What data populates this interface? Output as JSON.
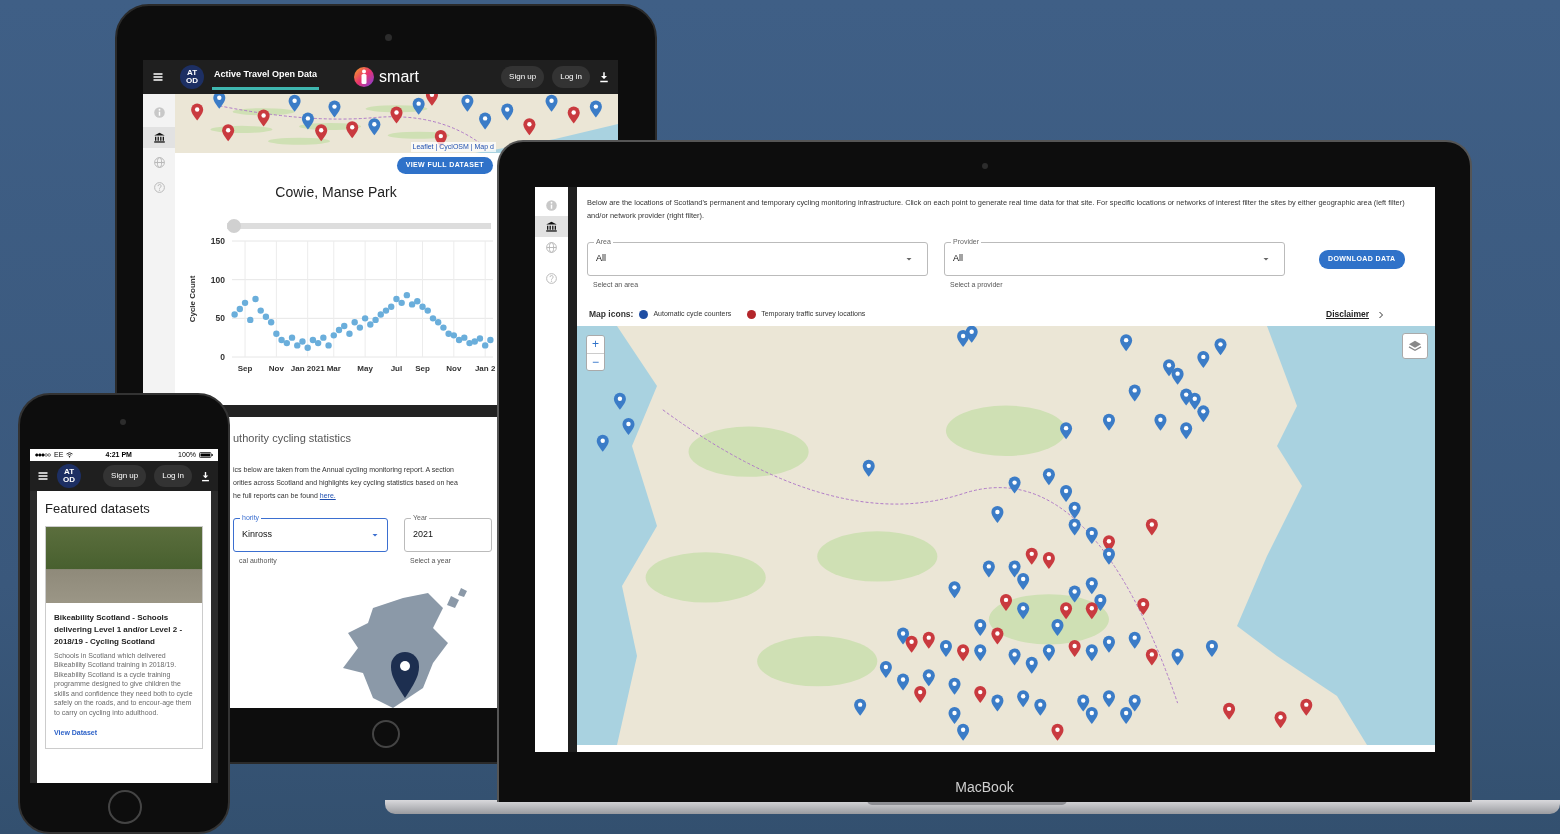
{
  "tablet": {
    "navbar": {
      "logo_text": "AT\nOD",
      "tab": {
        "label": "Active Travel Open Data",
        "selected": true
      },
      "brand": "smart",
      "buttons": [
        "Sign up",
        "Log in"
      ]
    },
    "sidebar": [
      {
        "kind": "info",
        "selected": false
      },
      {
        "kind": "bank",
        "selected": true
      },
      {
        "kind": "globe",
        "selected": false
      },
      {
        "kind": "help",
        "selected": false
      }
    ],
    "map_attribution": "Leaflet | CyclOSM | Map d",
    "view_button": "VIEW FULL DATASET",
    "chart_title": "Cowie, Manse Park",
    "range_slider": {
      "level": 0
    },
    "chart_data": {
      "type": "scatter",
      "grid": true,
      "ylabel": "Cycle Count",
      "ylim": [
        0,
        150
      ],
      "yticks": [
        0,
        50,
        100,
        150
      ],
      "categories": [
        null,
        null,
        "Sep",
        null,
        null,
        null,
        null,
        null,
        "Nov",
        null,
        null,
        null,
        null,
        null,
        "Jan 2021",
        null,
        null,
        null,
        null,
        "Mar",
        null,
        null,
        null,
        null,
        null,
        "May",
        null,
        null,
        null,
        null,
        null,
        "Jul",
        null,
        null,
        null,
        null,
        "Sep",
        null,
        null,
        null,
        null,
        null,
        "Nov",
        null,
        null,
        null,
        null,
        null,
        "Jan 2",
        null
      ],
      "values": [
        55,
        62,
        70,
        48,
        75,
        60,
        52,
        45,
        30,
        22,
        18,
        25,
        15,
        20,
        12,
        22,
        18,
        25,
        15,
        28,
        35,
        40,
        30,
        45,
        38,
        50,
        42,
        48,
        55,
        60,
        65,
        75,
        70,
        80,
        68,
        72,
        65,
        60,
        50,
        45,
        38,
        30,
        28,
        22,
        25,
        18,
        20,
        24,
        15,
        22
      ]
    },
    "stats": {
      "heading": "uthority cycling statistics",
      "text": "ics below are taken from the Annual cycling monitoring report. A section\norities across Scotland and highlights key cycling statistics based on hea\nhe full reports can be found ",
      "link": "here.",
      "fields": [
        {
          "kind": "select",
          "label": "hority",
          "value": "Kinross",
          "helper": "cal authority",
          "focused": true
        },
        {
          "kind": "input",
          "label": "Year",
          "value": "2021",
          "helper": "Select a year",
          "focused": false
        }
      ]
    }
  },
  "phone": {
    "status": {
      "carrier": "EE",
      "time": "4:21 PM",
      "battery": "100%"
    },
    "navbar": {
      "logo_text": "AT\nOD",
      "buttons": [
        "Sign up",
        "Log in"
      ]
    },
    "heading": "Featured datasets",
    "card": {
      "title": "Bikeability Scotland - Schools delivering Level 1 and/or Level 2 - 2018/19 - Cycling Scotland",
      "description": "Schools in Scotland which delivered Bikeability Scotland training in 2018/19. Bikeability Scotland is a cycle training programme designed to give children the skills and confidence they need both to cycle safely on the roads, and to encour-age them to carry on cycling into adulthood.",
      "link": "View Dataset"
    }
  },
  "laptop": {
    "sidebar": [
      {
        "kind": "info",
        "selected": false
      },
      {
        "kind": "bank",
        "selected": true
      },
      {
        "kind": "globe",
        "selected": false
      },
      {
        "kind": "help",
        "selected": false
      }
    ],
    "intro": "Below are the locations of Scotland's permanent and temporary cycling monitoring infrastructure. Click on each point to generate real time data for that site. For specific locations or networks of interest filter the sites by either geographic area (left filter) and/or network provider (right filter).",
    "filters": [
      {
        "label": "Area",
        "value": "All",
        "helper": "Select an area"
      },
      {
        "label": "Provider",
        "value": "All",
        "helper": "Select a provider"
      }
    ],
    "download_button": "DOWNLOAD DATA",
    "legend": {
      "label": "Map icons:",
      "items": [
        {
          "text": "Automatic cycle counters",
          "color": "#1f4ea3"
        },
        {
          "text": "Temporary traffic survey locations",
          "color": "#b3262b"
        }
      ]
    },
    "disclaimer": "Disclaimer",
    "zoom_buttons": [
      "+",
      "−"
    ]
  },
  "device_label": "MacBook"
}
